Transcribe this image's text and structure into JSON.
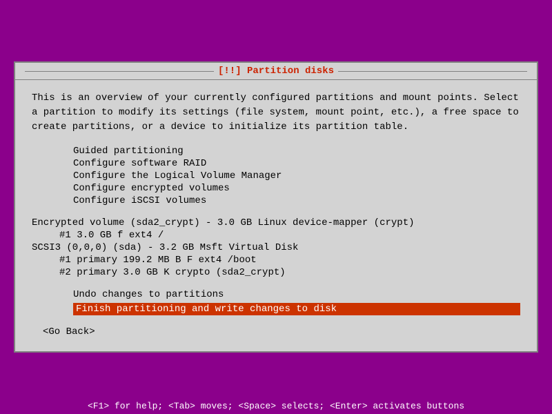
{
  "window": {
    "title": "[!!] Partition disks",
    "background_color": "#8B008B"
  },
  "dialog": {
    "description": "This is an overview of your currently configured partitions and mount points. Select a partition to modify its settings (file system, mount point, etc.), a free space to create partitions, or a device to initialize its partition table.",
    "menu_items": [
      "Guided partitioning",
      "Configure software RAID",
      "Configure the Logical Volume Manager",
      "Configure encrypted volumes",
      "Configure iSCSI volumes"
    ],
    "partitions": {
      "encrypted_volume": {
        "label": "Encrypted volume (sda2_crypt) - 3.0 GB Linux device-mapper (crypt)",
        "entry1": "#1          3.0 GB    f  ext4       /"
      },
      "scsi_device": {
        "label": "SCSI3 (0,0,0) (sda) - 3.2 GB Msft Virtual Disk",
        "entry1": "#1  primary   199.2 MB  B  F  ext4      /boot",
        "entry2": "#2  primary     3.0 GB     K  crypto    (sda2_crypt)"
      }
    },
    "actions": {
      "undo": "Undo changes to partitions",
      "finish": "Finish partitioning and write changes to disk"
    },
    "go_back": "<Go Back>"
  },
  "status_bar": {
    "text": "<F1> for help; <Tab> moves; <Space> selects; <Enter> activates buttons"
  }
}
